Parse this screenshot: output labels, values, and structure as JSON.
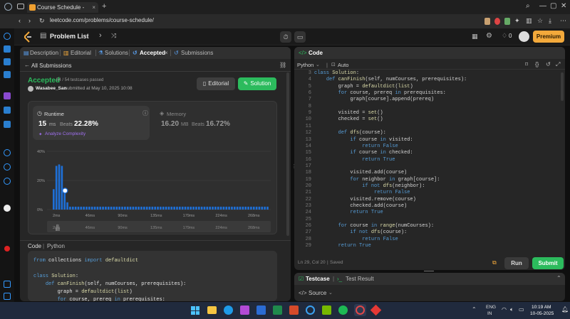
{
  "browser": {
    "tab_title": "Course Schedule - LeetCo",
    "url": "leetcode.com/problems/course-schedule/"
  },
  "header": {
    "problem_list": "Problem List",
    "coins": "0",
    "premium": "Premium"
  },
  "left_tabs": [
    {
      "label": "Description"
    },
    {
      "label": "Editorial"
    },
    {
      "label": "Solutions"
    },
    {
      "label": "Accepted"
    },
    {
      "label": "Submissions"
    }
  ],
  "submission": {
    "back_link": "All Submissions",
    "status": "Accepted",
    "testcases": "54 / 54 testcases passed",
    "user": "Wasabee_San",
    "submitted_text": "submitted at May 10, 2025 10:08",
    "editorial_btn": "Editorial",
    "solution_btn": "Solution"
  },
  "runtime": {
    "label": "Runtime",
    "value": "15",
    "unit": "ms",
    "beats_label": "Beats",
    "beats_value": "22.28%",
    "analyze": "Analyze Complexity"
  },
  "memory": {
    "label": "Memory",
    "value": "16.20",
    "unit": "MB",
    "beats_label": "Beats",
    "beats_value": "16.72%"
  },
  "chart_data": {
    "type": "bar",
    "ylabel_ticks": [
      "40%",
      "20%",
      "0%"
    ],
    "ylim": [
      0,
      40
    ],
    "x_ticks": [
      "2ms",
      "46ms",
      "90ms",
      "135ms",
      "179ms",
      "224ms",
      "268ms"
    ],
    "values": [
      14,
      30,
      31,
      30,
      13,
      5,
      2,
      2,
      2,
      2,
      2,
      2,
      2,
      2,
      2,
      2,
      2,
      2,
      2,
      2,
      2,
      2,
      2,
      2,
      2,
      2,
      2,
      2,
      2,
      2,
      2,
      2,
      2,
      2,
      2,
      2,
      2,
      2,
      2,
      2,
      2,
      2,
      2,
      2,
      2,
      2,
      2,
      2,
      2,
      2,
      2,
      2,
      2,
      2,
      2,
      2,
      2,
      2,
      2,
      2,
      2,
      2,
      2,
      2,
      2,
      2,
      2,
      2,
      2,
      2,
      2,
      2,
      2,
      2,
      2,
      2,
      2,
      2,
      2
    ],
    "highlight_index": 4,
    "grid": true,
    "colors": {
      "bar": "#1e6fd6",
      "highlight": "#ffffff"
    }
  },
  "code_section": {
    "label": "Code",
    "lang": "Python",
    "lines": [
      "from collections import defaultdict",
      "",
      "class Solution:",
      "    def canFinish(self, numCourses, prerequisites):",
      "        graph = defaultdict(list)",
      "        for course, prereq in prerequisites:"
    ]
  },
  "editor": {
    "title": "Code",
    "language": "Python",
    "mode": "Auto",
    "status": "Ln 29, Col 20",
    "saved": "Saved",
    "run": "Run",
    "submit": "Submit",
    "lines": [
      {
        "n": "3",
        "t": "class Solution:"
      },
      {
        "n": "4",
        "t": "    def canFinish(self, numCourses, prerequisites):"
      },
      {
        "n": "5",
        "t": "        graph = defaultdict(list)"
      },
      {
        "n": "6",
        "t": "        for course, prereq in prerequisites:"
      },
      {
        "n": "7",
        "t": "            graph[course].append(prereq)"
      },
      {
        "n": "8",
        "t": ""
      },
      {
        "n": "9",
        "t": "        visited = set()"
      },
      {
        "n": "10",
        "t": "        checked = set()"
      },
      {
        "n": "11",
        "t": ""
      },
      {
        "n": "12",
        "t": "        def dfs(course):"
      },
      {
        "n": "13",
        "t": "            if course in visited:"
      },
      {
        "n": "14",
        "t": "                return False"
      },
      {
        "n": "15",
        "t": "            if course in checked:"
      },
      {
        "n": "16",
        "t": "                return True"
      },
      {
        "n": "17",
        "t": ""
      },
      {
        "n": "18",
        "t": "            visited.add(course)"
      },
      {
        "n": "19",
        "t": "            for neighbor in graph[course]:"
      },
      {
        "n": "20",
        "t": "                if not dfs(neighbor):"
      },
      {
        "n": "21",
        "t": "                    return False"
      },
      {
        "n": "22",
        "t": "            visited.remove(course)"
      },
      {
        "n": "23",
        "t": "            checked.add(course)"
      },
      {
        "n": "24",
        "t": "            return True"
      },
      {
        "n": "25",
        "t": ""
      },
      {
        "n": "26",
        "t": "        for course in range(numCourses):"
      },
      {
        "n": "27",
        "t": "            if not dfs(course):"
      },
      {
        "n": "28",
        "t": "                return False"
      },
      {
        "n": "29",
        "t": "        return True"
      }
    ]
  },
  "bottom_panel": {
    "testcase": "Testcase",
    "test_result": "Test Result",
    "source": "Source"
  },
  "taskbar": {
    "lang": "ENG",
    "region": "IN",
    "time": "10:19 AM",
    "date": "10-05-2025"
  }
}
